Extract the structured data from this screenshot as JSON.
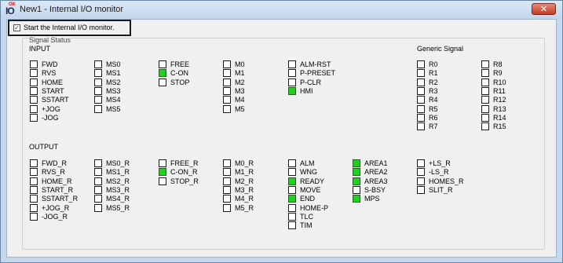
{
  "window": {
    "title": "New1 - Internal I/O monitor",
    "close_glyph": "✕",
    "icon": "io-app-icon",
    "icon_letters": "IO",
    "icon_superscript": "OK"
  },
  "start_monitor": {
    "label": "Start the Internal I/O monitor.",
    "checked": true
  },
  "signal_status": {
    "label": "Signal Status"
  },
  "input": {
    "heading": "INPUT",
    "columns": [
      [
        {
          "name": "FWD",
          "on": false
        },
        {
          "name": "RVS",
          "on": false
        },
        {
          "name": "HOME",
          "on": false
        },
        {
          "name": "START",
          "on": false
        },
        {
          "name": "SSTART",
          "on": false
        },
        {
          "name": "+JOG",
          "on": false
        },
        {
          "name": "-JOG",
          "on": false
        }
      ],
      [
        {
          "name": "MS0",
          "on": false
        },
        {
          "name": "MS1",
          "on": false
        },
        {
          "name": "MS2",
          "on": false
        },
        {
          "name": "MS3",
          "on": false
        },
        {
          "name": "MS4",
          "on": false
        },
        {
          "name": "MS5",
          "on": false
        }
      ],
      [
        {
          "name": "FREE",
          "on": false
        },
        {
          "name": "C-ON",
          "on": true
        },
        {
          "name": "STOP",
          "on": false
        }
      ],
      [
        {
          "name": "M0",
          "on": false
        },
        {
          "name": "M1",
          "on": false
        },
        {
          "name": "M2",
          "on": false
        },
        {
          "name": "M3",
          "on": false
        },
        {
          "name": "M4",
          "on": false
        },
        {
          "name": "M5",
          "on": false
        }
      ],
      [
        {
          "name": "ALM-RST",
          "on": false
        },
        {
          "name": "P-PRESET",
          "on": false
        },
        {
          "name": "P-CLR",
          "on": false
        },
        {
          "name": "HMI",
          "on": true
        }
      ]
    ]
  },
  "generic": {
    "heading": "Generic Signal",
    "columns": [
      [
        {
          "name": "R0",
          "on": false
        },
        {
          "name": "R1",
          "on": false
        },
        {
          "name": "R2",
          "on": false
        },
        {
          "name": "R3",
          "on": false
        },
        {
          "name": "R4",
          "on": false
        },
        {
          "name": "R5",
          "on": false
        },
        {
          "name": "R6",
          "on": false
        },
        {
          "name": "R7",
          "on": false
        }
      ],
      [
        {
          "name": "R8",
          "on": false
        },
        {
          "name": "R9",
          "on": false
        },
        {
          "name": "R10",
          "on": false
        },
        {
          "name": "R11",
          "on": false
        },
        {
          "name": "R12",
          "on": false
        },
        {
          "name": "R13",
          "on": false
        },
        {
          "name": "R14",
          "on": false
        },
        {
          "name": "R15",
          "on": false
        }
      ]
    ]
  },
  "output": {
    "heading": "OUTPUT",
    "columns": [
      [
        {
          "name": "FWD_R",
          "on": false
        },
        {
          "name": "RVS_R",
          "on": false
        },
        {
          "name": "HOME_R",
          "on": false
        },
        {
          "name": "START_R",
          "on": false
        },
        {
          "name": "SSTART_R",
          "on": false
        },
        {
          "name": "+JOG_R",
          "on": false
        },
        {
          "name": "-JOG_R",
          "on": false
        }
      ],
      [
        {
          "name": "MS0_R",
          "on": false
        },
        {
          "name": "MS1_R",
          "on": false
        },
        {
          "name": "MS2_R",
          "on": false
        },
        {
          "name": "MS3_R",
          "on": false
        },
        {
          "name": "MS4_R",
          "on": false
        },
        {
          "name": "MS5_R",
          "on": false
        }
      ],
      [
        {
          "name": "FREE_R",
          "on": false
        },
        {
          "name": "C-ON_R",
          "on": true
        },
        {
          "name": "STOP_R",
          "on": false
        }
      ],
      [
        {
          "name": "M0_R",
          "on": false
        },
        {
          "name": "M1_R",
          "on": false
        },
        {
          "name": "M2_R",
          "on": false
        },
        {
          "name": "M3_R",
          "on": false
        },
        {
          "name": "M4_R",
          "on": false
        },
        {
          "name": "M5_R",
          "on": false
        }
      ],
      [
        {
          "name": "ALM",
          "on": false
        },
        {
          "name": "WNG",
          "on": false
        },
        {
          "name": "READY",
          "on": true
        },
        {
          "name": "MOVE",
          "on": false
        },
        {
          "name": "END",
          "on": true
        },
        {
          "name": "HOME-P",
          "on": false
        },
        {
          "name": "TLC",
          "on": false
        },
        {
          "name": "TIM",
          "on": false
        }
      ],
      [
        {
          "name": "AREA1",
          "on": true
        },
        {
          "name": "AREA2",
          "on": true
        },
        {
          "name": "AREA3",
          "on": true
        },
        {
          "name": "S-BSY",
          "on": false
        },
        {
          "name": "MPS",
          "on": true
        }
      ],
      [
        {
          "name": "+LS_R",
          "on": false
        },
        {
          "name": "-LS_R",
          "on": false
        },
        {
          "name": "HOMES_R",
          "on": false
        },
        {
          "name": "SLIT_R",
          "on": false
        }
      ]
    ]
  },
  "colors": {
    "on": "#22d01e",
    "off": "#ffffff",
    "titlebar": "#c6d8ee",
    "close": "#c13b24"
  }
}
